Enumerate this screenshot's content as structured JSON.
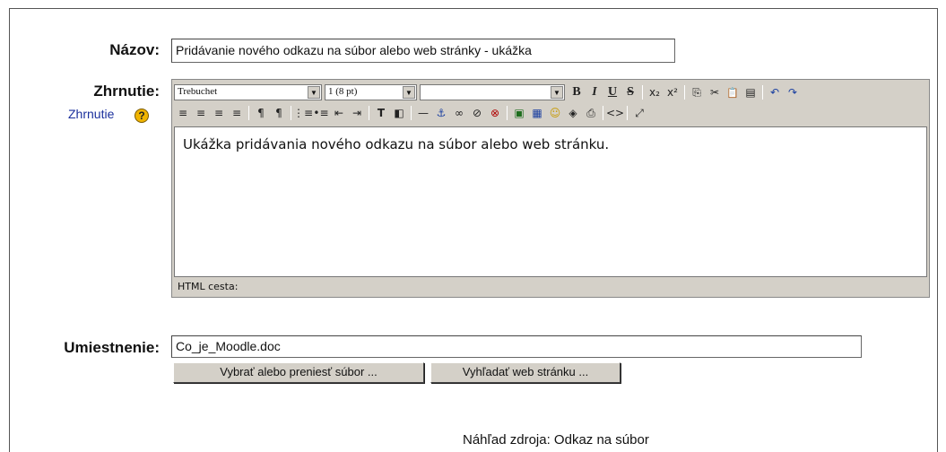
{
  "form": {
    "name_label": "Názov:",
    "name_value": "Pridávanie nového odkazu na súbor alebo web stránky - ukážka",
    "summary_label": "Zhrnutie:",
    "summary_help_link": "Zhrnutie",
    "summary_help_icon": "?",
    "location_label": "Umiestnenie:",
    "location_value": "Co_je_Moodle.doc",
    "choose_file_button": "Vybrať alebo preniesť súbor ...",
    "search_web_button": "Vyhľadať web stránku ...",
    "preview_text": "Náhľad zdroja: Odkaz na súbor"
  },
  "editor": {
    "font_select": "Trebuchet",
    "size_select": "1 (8 pt)",
    "format_select": "",
    "content": "Ukážka pridávania nového odkazu na súbor alebo web stránku.",
    "path_label": "HTML cesta:",
    "toolbar_row1": {
      "bold": "B",
      "italic": "I",
      "underline": "U",
      "strike": "S",
      "subscript": "x₂",
      "superscript": "x²",
      "copy": "⎘",
      "cut": "✂",
      "paste": "📋",
      "paste_word": "▤",
      "undo": "↶",
      "redo": "↷"
    },
    "toolbar_row2": {
      "align_left": "≡",
      "align_center": "≡",
      "align_right": "≡",
      "justify": "≡",
      "ltr": "¶",
      "rtl": "¶",
      "ordered_list": "⋮≡",
      "unordered_list": "•≡",
      "outdent": "⇤",
      "indent": "⇥",
      "text_color": "T",
      "bg_color": "◧",
      "hr": "—",
      "anchor": "⚓",
      "link": "∞",
      "unlink": "⊘",
      "nolink": "⊗",
      "image": "▣",
      "table": "▦",
      "smiley": "☺",
      "special_char": "◈",
      "search_replace": "⎙",
      "html_source": "<>",
      "fullscreen": "⤢"
    }
  }
}
